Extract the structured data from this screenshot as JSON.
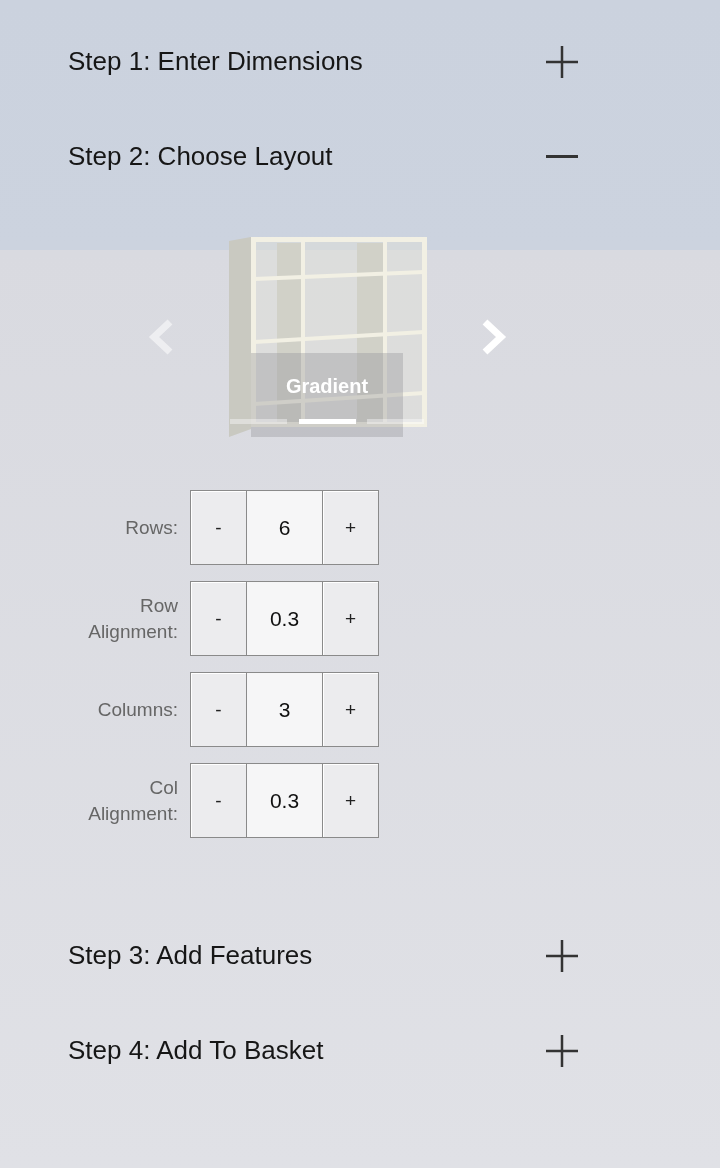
{
  "steps": [
    {
      "label": "Step 1: Enter Dimensions",
      "expanded": false
    },
    {
      "label": "Step 2: Choose Layout",
      "expanded": true,
      "layout": {
        "arrows": [
          {
            "kind": "previous",
            "disabled": true
          },
          {
            "kind": "next",
            "disabled": false
          }
        ],
        "caption": "Gradient",
        "slides": [
          {
            "selected": false
          },
          {
            "selected": true
          },
          {
            "selected": false
          }
        ],
        "settings": [
          {
            "label": "Rows:",
            "decrement": "-",
            "value": "6",
            "increment": "+"
          },
          {
            "label": "Row Alignment:",
            "decrement": "-",
            "value": "0.3",
            "increment": "+"
          },
          {
            "label": "Columns:",
            "decrement": "-",
            "value": "3",
            "increment": "+"
          },
          {
            "label": "Col Alignment:",
            "decrement": "-",
            "value": "0.3",
            "increment": "+"
          }
        ]
      }
    },
    {
      "label": "Step 3: Add Features",
      "expanded": false
    },
    {
      "label": "Step 4: Add To Basket",
      "expanded": false
    }
  ]
}
